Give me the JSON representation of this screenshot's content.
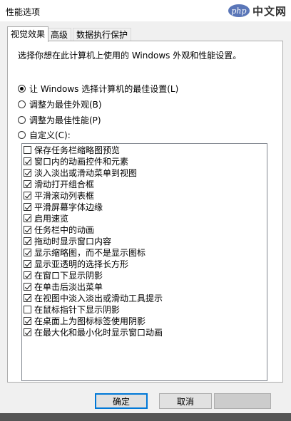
{
  "window": {
    "title": "性能选项"
  },
  "watermark": {
    "logo": "php",
    "text": "中文网"
  },
  "tabs": [
    {
      "label": "视觉效果",
      "active": true
    },
    {
      "label": "高级",
      "active": false
    },
    {
      "label": "数据执行保护",
      "active": false
    }
  ],
  "description": "选择你想在此计算机上使用的 Windows 外观和性能设置。",
  "radios": [
    {
      "label": "让 Windows 选择计算机的最佳设置(L)",
      "checked": true
    },
    {
      "label": "调整为最佳外观(B)",
      "checked": false
    },
    {
      "label": "调整为最佳性能(P)",
      "checked": false
    },
    {
      "label": "自定义(C):",
      "checked": false
    }
  ],
  "options": [
    {
      "label": "保存任务栏缩略图预览",
      "checked": false
    },
    {
      "label": "窗口内的动画控件和元素",
      "checked": true
    },
    {
      "label": "淡入淡出或滑动菜单到视图",
      "checked": true
    },
    {
      "label": "滑动打开组合框",
      "checked": true
    },
    {
      "label": "平滑滚动列表框",
      "checked": true
    },
    {
      "label": "平滑屏幕字体边缘",
      "checked": true
    },
    {
      "label": "启用速览",
      "checked": true
    },
    {
      "label": "任务栏中的动画",
      "checked": true
    },
    {
      "label": "拖动时显示窗口内容",
      "checked": true
    },
    {
      "label": "显示缩略图，而不是显示图标",
      "checked": true
    },
    {
      "label": "显示亚透明的选择长方形",
      "checked": true
    },
    {
      "label": "在窗口下显示阴影",
      "checked": true
    },
    {
      "label": "在单击后淡出菜单",
      "checked": true
    },
    {
      "label": "在视图中淡入淡出或滑动工具提示",
      "checked": true
    },
    {
      "label": "在鼠标指针下显示阴影",
      "checked": false
    },
    {
      "label": "在桌面上为图标标签使用阴影",
      "checked": true
    },
    {
      "label": "在最大化和最小化时显示窗口动画",
      "checked": true
    }
  ],
  "buttons": {
    "ok": "确定",
    "cancel": "取消"
  }
}
